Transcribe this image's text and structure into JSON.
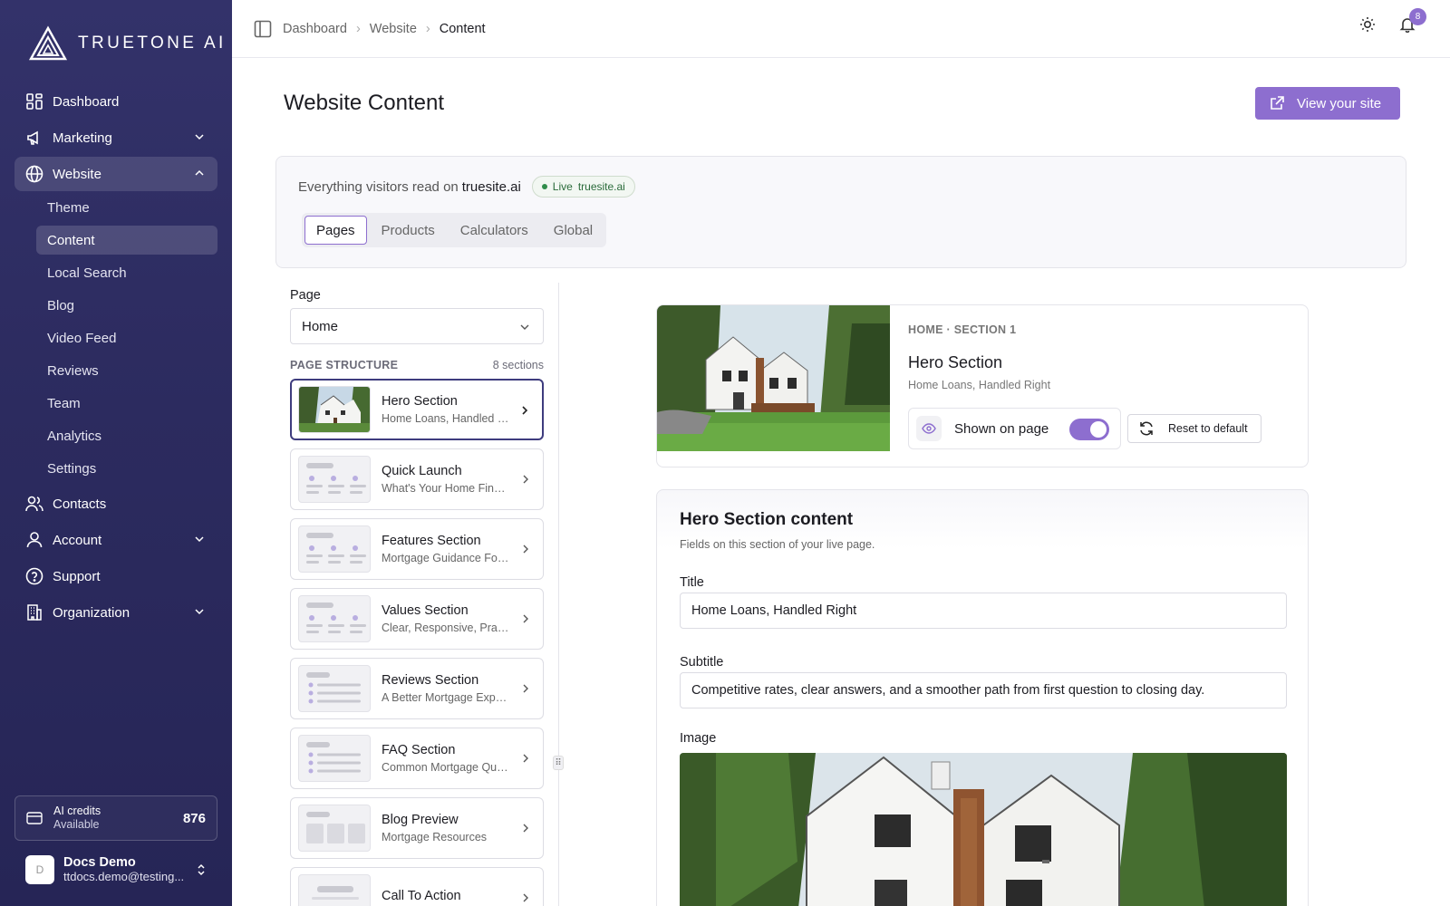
{
  "brand": {
    "name": "TRUETONE AI"
  },
  "sidebar": {
    "items": [
      {
        "label": "Dashboard",
        "icon": "dashboard-icon"
      },
      {
        "label": "Marketing",
        "icon": "megaphone-icon"
      },
      {
        "label": "Website",
        "icon": "globe-icon"
      },
      {
        "label": "Contacts",
        "icon": "users-icon"
      },
      {
        "label": "Account",
        "icon": "user-icon"
      },
      {
        "label": "Support",
        "icon": "help-circle-icon"
      },
      {
        "label": "Organization",
        "icon": "building-icon"
      }
    ],
    "website_sub": [
      "Theme",
      "Content",
      "Local Search",
      "Blog",
      "Video Feed",
      "Reviews",
      "Team",
      "Analytics",
      "Settings"
    ],
    "credits": {
      "label": "AI credits",
      "sublabel": "Available",
      "value": "876"
    },
    "user": {
      "initial": "D",
      "name": "Docs Demo",
      "email": "ttdocs.demo@testing..."
    }
  },
  "topbar": {
    "breadcrumbs": [
      "Dashboard",
      "Website",
      "Content"
    ],
    "notification_count": "8"
  },
  "page": {
    "title": "Website Content",
    "view_site_label": "View your site",
    "visitors_text": "Everything visitors read on",
    "domain": "truesite.ai",
    "live_label": "Live",
    "live_domain": "truesite.ai",
    "tabs": [
      "Pages",
      "Products",
      "Calculators",
      "Global"
    ]
  },
  "structure": {
    "page_label": "Page",
    "page_value": "Home",
    "heading": "PAGE STRUCTURE",
    "count": "8 sections",
    "sections": [
      {
        "name": "Hero Section",
        "desc": "Home Loans, Handled Right"
      },
      {
        "name": "Quick Launch",
        "desc": "What's Your Home Financing Goal?"
      },
      {
        "name": "Features Section",
        "desc": "Mortgage Guidance For Every Step"
      },
      {
        "name": "Values Section",
        "desc": "Clear, Responsive, Practical"
      },
      {
        "name": "Reviews Section",
        "desc": "A Better Mortgage Experience"
      },
      {
        "name": "FAQ Section",
        "desc": "Common Mortgage Questions"
      },
      {
        "name": "Blog Preview",
        "desc": "Mortgage Resources"
      },
      {
        "name": "Call To Action",
        "desc": ""
      }
    ]
  },
  "preview": {
    "meta": "HOME · SECTION 1",
    "title": "Hero Section",
    "subtitle": "Home Loans, Handled Right",
    "shown_label": "Shown on page",
    "shown_on": true,
    "reset_label": "Reset to default"
  },
  "content": {
    "title": "Hero Section content",
    "subtitle": "Fields on this section of your live page.",
    "fields": {
      "title_label": "Title",
      "title_value": "Home Loans, Handled Right",
      "subtitle_label": "Subtitle",
      "subtitle_value": "Competitive rates, clear answers, and a smoother path from first question to closing day.",
      "image_label": "Image"
    }
  },
  "colors": {
    "accent": "#8d6ecf",
    "sidebar": "#2c2b5f"
  }
}
